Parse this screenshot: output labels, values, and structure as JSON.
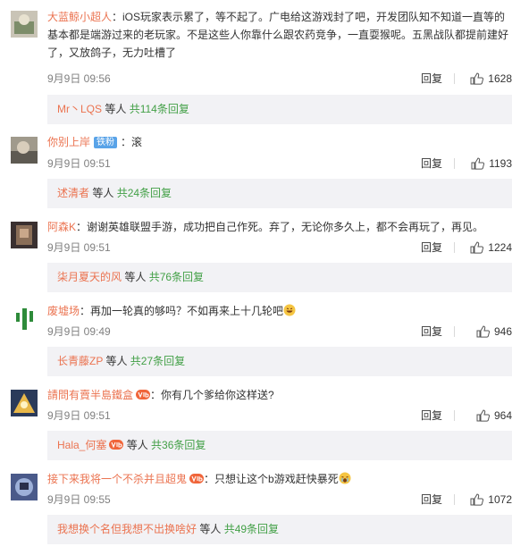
{
  "comments": [
    {
      "user": "大蓝鲸小超人",
      "text_line1": "：iOS玩家表示累了，等不起了。广电给这游戏封了吧，开发团队知不知道一直等的",
      "text_line2": "基本都是端游过来的老玩家。不是这些人你靠什么跟农药竞争，一直耍猴呢。五黑战队都提前建好",
      "text_line3": "了，又放鸽子，无力吐槽了",
      "time": "9月9日 09:56",
      "reply_label": "回复",
      "likes": "1628",
      "sub_user": "Mr丶LQS",
      "sub_text": " 等人 ",
      "sub_count": "共114条回复"
    },
    {
      "user": "你别上岸",
      "badge": "铁粉",
      "text_line1": "：滚",
      "time": "9月9日 09:51",
      "reply_label": "回复",
      "likes": "1193",
      "sub_user": "述清者",
      "sub_text": " 等人 ",
      "sub_count": "共24条回复"
    },
    {
      "user": "阿森K",
      "text_line1": "：谢谢英雄联盟手游，成功把自己作死。弃了，无论你多久上，都不会再玩了，再见。",
      "time": "9月9日 09:51",
      "reply_label": "回复",
      "likes": "1224",
      "sub_user": "柒月夏天的风",
      "sub_text": " 等人 ",
      "sub_count": "共76条回复"
    },
    {
      "user": "废墟场",
      "text_line1": "：再加一轮真的够吗？不如再来上十几轮吧",
      "time": "9月9日 09:49",
      "reply_label": "回复",
      "likes": "946",
      "sub_user": "长青藤ZP",
      "sub_text": " 等人 ",
      "sub_count": "共27条回复"
    },
    {
      "user": "請問有賣半島鐵盒",
      "text_line1": "：你有几个爹给你这样送?",
      "time": "9月9日 09:51",
      "reply_label": "回复",
      "likes": "964",
      "sub_user": "Hala_何塞",
      "sub_text": " 等人 ",
      "sub_count": "共36条回复"
    },
    {
      "user": "接下来我将一个不杀并且超鬼",
      "text_line1": "：只想让这个b游戏赶快暴死",
      "time": "9月9日 09:55",
      "reply_label": "回复",
      "likes": "1072",
      "sub_user": "我想换个名但我想不出换啥好",
      "sub_text": " 等人 ",
      "sub_count": "共49条回复"
    }
  ],
  "colors": {
    "username": "#eb7350",
    "count": "#43a047",
    "badge": "#59a3e8",
    "subbox_bg": "#f2f2f5"
  }
}
